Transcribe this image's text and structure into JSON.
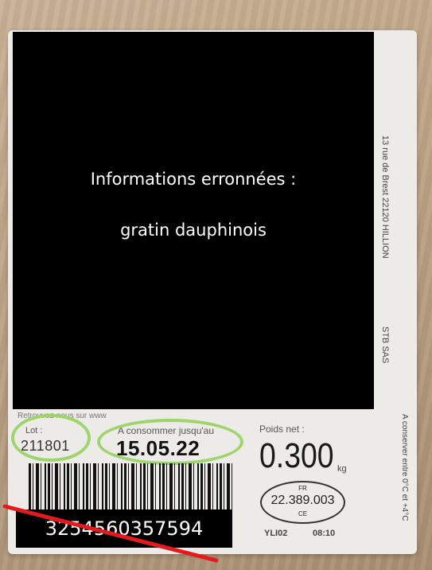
{
  "overlay": {
    "line1": "Informations erronnées :",
    "line2": "gratin dauphinois"
  },
  "label": {
    "site": "Retrouvez-nous sur www",
    "lot_label": "Lot :",
    "lot_value": "211801",
    "dlc_label": "A consommer jusqu'au",
    "dlc_value": "15.05.22",
    "weight_label": "Poids net :",
    "weight_value": "0.300",
    "weight_unit": "kg",
    "health_mark": {
      "country": "FR",
      "number": "22.389.003",
      "ce": "CE"
    },
    "line_code": "YLI02",
    "time": "08:10",
    "ean": "3254560357594",
    "company_address": "13 rue de Brest 22120 HILLION",
    "company_name": "STB SAS",
    "storage": "A conserver entre 0°C et +4°C"
  },
  "colors": {
    "highlight": "#9ed46a",
    "strike": "#e8191b"
  }
}
